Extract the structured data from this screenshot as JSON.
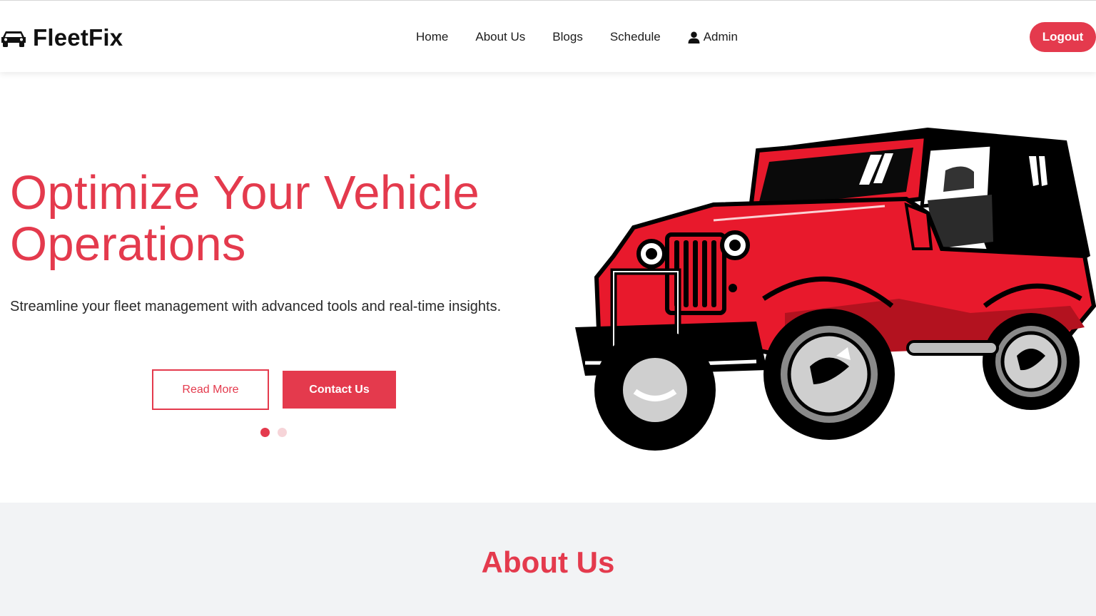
{
  "brand": {
    "name": "FleetFix",
    "icon": "car-icon"
  },
  "nav": {
    "links": [
      "Home",
      "About Us",
      "Blogs",
      "Schedule"
    ],
    "admin_label": "Admin",
    "admin_icon": "user-icon",
    "logout_label": "Logout"
  },
  "hero": {
    "title": "Optimize Your Vehicle Operations",
    "subtitle": "Streamline your fleet management with advanced tools and real-time insights.",
    "read_more_label": "Read More",
    "contact_label": "Contact Us",
    "carousel": {
      "slides": 2,
      "active_slide": 1
    },
    "image": "red-jeep-illustration"
  },
  "about": {
    "title": "About Us"
  },
  "colors": {
    "accent": "#e43a4d",
    "dot_inactive": "#f6d4d8",
    "about_bg": "#f2f3f5"
  }
}
